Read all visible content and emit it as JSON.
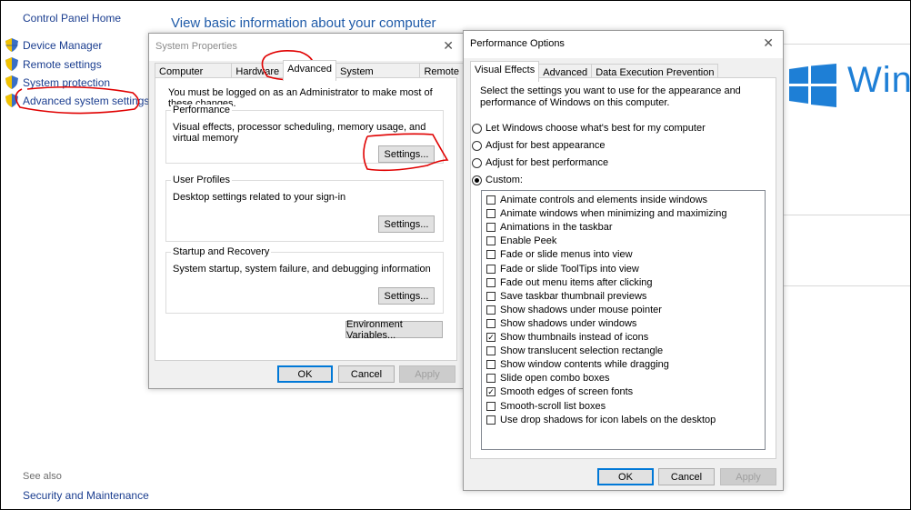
{
  "control_panel": {
    "home": "Control Panel Home",
    "links": [
      "Device Manager",
      "Remote settings",
      "System protection",
      "Advanced system settings"
    ],
    "title": "View basic information about your computer",
    "see_also": "See also",
    "security_link": "Security and Maintenance",
    "windows_text": "Win"
  },
  "system_properties": {
    "title": "System Properties",
    "tabs": [
      "Computer Name",
      "Hardware",
      "Advanced",
      "System Protection",
      "Remote"
    ],
    "admin_note": "You must be logged on as an Administrator to make most of these changes.",
    "performance": {
      "title": "Performance",
      "desc": "Visual effects, processor scheduling, memory usage, and virtual memory",
      "button": "Settings..."
    },
    "user_profiles": {
      "title": "User Profiles",
      "desc": "Desktop settings related to your sign-in",
      "button": "Settings..."
    },
    "startup": {
      "title": "Startup and Recovery",
      "desc": "System startup, system failure, and debugging information",
      "button": "Settings..."
    },
    "env_button": "Environment Variables...",
    "ok": "OK",
    "cancel": "Cancel",
    "apply": "Apply"
  },
  "performance_options": {
    "title": "Performance Options",
    "tabs": [
      "Visual Effects",
      "Advanced",
      "Data Execution Prevention"
    ],
    "instruction_1": "Select the settings you want to use for the appearance and",
    "instruction_2": "performance of Windows on this computer.",
    "radios": [
      {
        "label": "Let Windows choose what's best for my computer",
        "checked": false
      },
      {
        "label": "Adjust for best appearance",
        "checked": false
      },
      {
        "label": "Adjust for best performance",
        "checked": false
      },
      {
        "label": "Custom:",
        "checked": true
      }
    ],
    "effects": [
      {
        "label": "Animate controls and elements inside windows",
        "checked": false
      },
      {
        "label": "Animate windows when minimizing and maximizing",
        "checked": false
      },
      {
        "label": "Animations in the taskbar",
        "checked": false
      },
      {
        "label": "Enable Peek",
        "checked": false
      },
      {
        "label": "Fade or slide menus into view",
        "checked": false
      },
      {
        "label": "Fade or slide ToolTips into view",
        "checked": false
      },
      {
        "label": "Fade out menu items after clicking",
        "checked": false
      },
      {
        "label": "Save taskbar thumbnail previews",
        "checked": false
      },
      {
        "label": "Show shadows under mouse pointer",
        "checked": false
      },
      {
        "label": "Show shadows under windows",
        "checked": false
      },
      {
        "label": "Show thumbnails instead of icons",
        "checked": true
      },
      {
        "label": "Show translucent selection rectangle",
        "checked": false
      },
      {
        "label": "Show window contents while dragging",
        "checked": false
      },
      {
        "label": "Slide open combo boxes",
        "checked": false
      },
      {
        "label": "Smooth edges of screen fonts",
        "checked": true
      },
      {
        "label": "Smooth-scroll list boxes",
        "checked": false
      },
      {
        "label": "Use drop shadows for icon labels on the desktop",
        "checked": false
      }
    ],
    "ok": "OK",
    "cancel": "Cancel",
    "apply": "Apply"
  },
  "colors": {
    "link": "#1a3d8f",
    "title": "#1e5aa8",
    "accent": "#0078d7",
    "annotation": "#e00000",
    "windows_blue": "#1e7fd6"
  }
}
